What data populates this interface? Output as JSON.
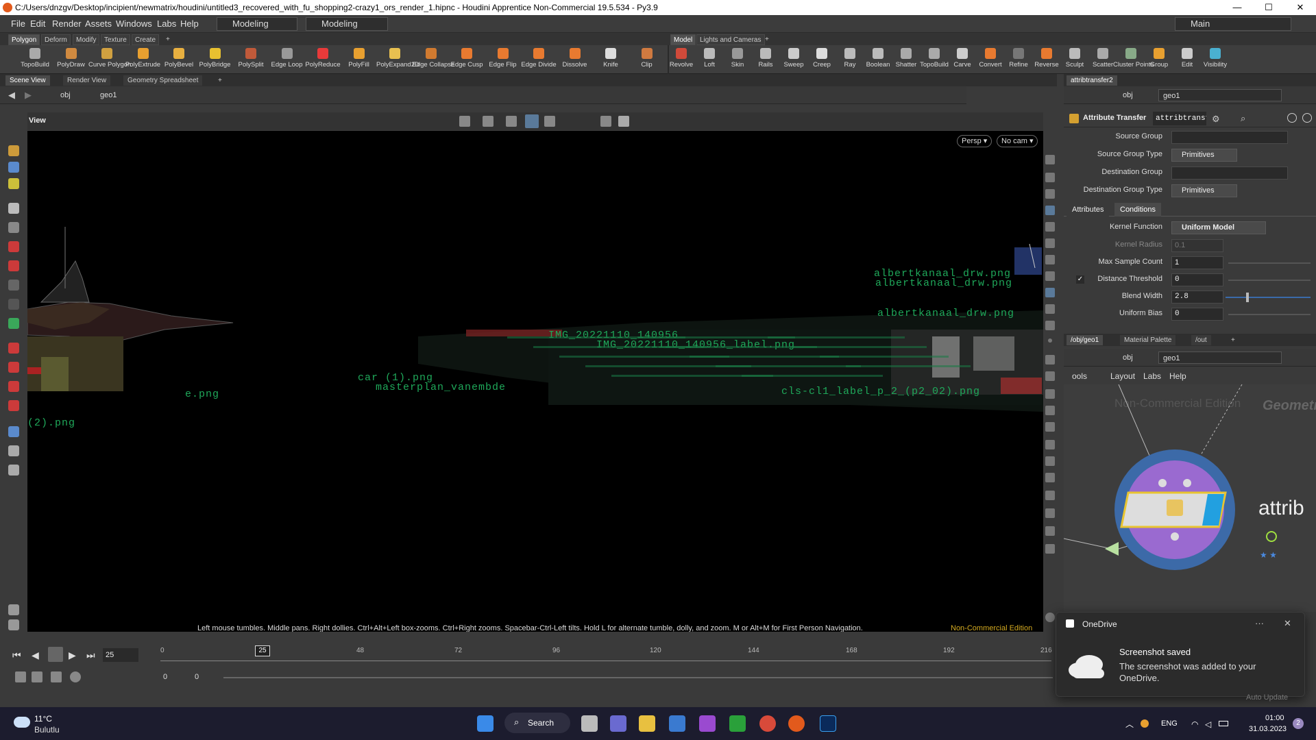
{
  "window": {
    "title": "C:/Users/dnzgv/Desktop/incipient/newmatrix/houdini/untitled3_recovered_with_fu_shopping2-crazy1_ors_render_1.hipnc - Houdini Apprentice Non-Commercial 19.5.534 - Py3.9",
    "minimize": "—",
    "maximize": "☐",
    "close": "✕"
  },
  "menu": {
    "items": [
      "File",
      "Edit",
      "Render",
      "Assets",
      "Windows",
      "Labs",
      "Help"
    ],
    "desktop1": "Modeling",
    "desktop2": "Modeling",
    "main": "Main"
  },
  "shelf_left": {
    "tabs": [
      "Polygon",
      "Deform",
      "Modify",
      "Texture",
      "Create",
      "+"
    ],
    "tools": [
      "TopoBuild",
      "PolyDraw",
      "Curve Polygon",
      "PolyExtrude",
      "PolyBevel",
      "PolyBridge",
      "PolySplit",
      "Edge Loop",
      "PolyReduce",
      "PolyFill",
      "PolyExpand2D",
      "Edge Collapse",
      "Edge Cusp",
      "Edge Flip",
      "Edge Divide",
      "Dissolve",
      "Knife",
      "Clip"
    ]
  },
  "shelf_right": {
    "tabs": [
      "Model",
      "Lights and Cameras",
      "+"
    ],
    "tools": [
      "Revolve",
      "Loft",
      "Skin",
      "Rails",
      "Sweep",
      "Creep",
      "Ray",
      "Boolean",
      "Shatter",
      "TopoBuild",
      "Carve",
      "Convert",
      "Refine",
      "Reverse",
      "Sculpt",
      "Scatter",
      "Cluster Points",
      "Group",
      "Edit",
      "Visibility"
    ]
  },
  "viewer": {
    "tabs": [
      "Scene View",
      "Render View",
      "Geometry Spreadsheet",
      "+"
    ],
    "path_obj": "obj",
    "path_geo": "geo1",
    "view_label": "View",
    "persp": "Persp ▾",
    "cam": "No cam ▾",
    "hint": "Left mouse tumbles. Middle pans. Right dollies. Ctrl+Alt+Left box-zooms. Ctrl+Right zooms. Spacebar-Ctrl-Left tilts. Hold L for alternate tumble, dolly, and zoom.     M or Alt+M for First Person Navigation.",
    "edition": "Non-Commercial Edition"
  },
  "viewport_labels": [
    "albertkanaal_drw.png",
    "albertkanaal_drw.png",
    "albertkanaal_drw.png",
    "IMG_20221110_140956_label.png",
    "car (1).png",
    "masterplan_vanembde",
    "cls-cl1_label_p_2_(p2_02).png",
    "IMG_20221110_140956",
    "e.png",
    "(2).png"
  ],
  "parms": {
    "tab": "attribtransfer2",
    "path_obj": "obj",
    "path_geo": "geo1",
    "node_type": "Attribute Transfer",
    "node_name": "attribtransfer2",
    "source_group": "Source Group",
    "source_group_type": "Source Group Type",
    "source_group_type_val": "Primitives",
    "dest_group": "Destination Group",
    "dest_group_type": "Destination Group Type",
    "dest_group_type_val": "Primitives",
    "tab_attributes": "Attributes",
    "tab_conditions": "Conditions",
    "kernel_function": "Kernel Function",
    "kernel_function_val": "Uniform Model",
    "kernel_radius": "Kernel Radius",
    "kernel_radius_val": "0.1",
    "max_sample": "Max Sample Count",
    "max_sample_val": "1",
    "dist_threshold": "Distance Threshold",
    "dist_threshold_val": "0",
    "blend_width": "Blend Width",
    "blend_width_val": "2.8",
    "uniform_bias": "Uniform Bias",
    "uniform_bias_val": "0"
  },
  "network": {
    "tabs": [
      "/obj/geo1",
      "Material Palette",
      "/out",
      "+"
    ],
    "path_obj": "obj",
    "path_geo": "geo1",
    "menu": [
      "ools",
      "Layout",
      "Labs",
      "Help"
    ],
    "watermark": "Non-Commercial Edition",
    "context": "Geometry",
    "node_label": "attrib"
  },
  "timeline": {
    "frame": "25",
    "marker": "25",
    "ticks": [
      "0",
      "48",
      "72",
      "96",
      "120",
      "144",
      "168",
      "192",
      "216"
    ],
    "start": "0",
    "end": "0"
  },
  "notification": {
    "app": "OneDrive",
    "title": "Screenshot saved",
    "body": "The screenshot was added to your OneDrive.",
    "more": "···",
    "close": "✕",
    "under": "Auto Update"
  },
  "taskbar": {
    "temp": "11°C",
    "weather": "Bulutlu",
    "search": "Search",
    "lang": "ENG",
    "time": "01:00",
    "date": "31.03.2023",
    "badge": "2"
  }
}
